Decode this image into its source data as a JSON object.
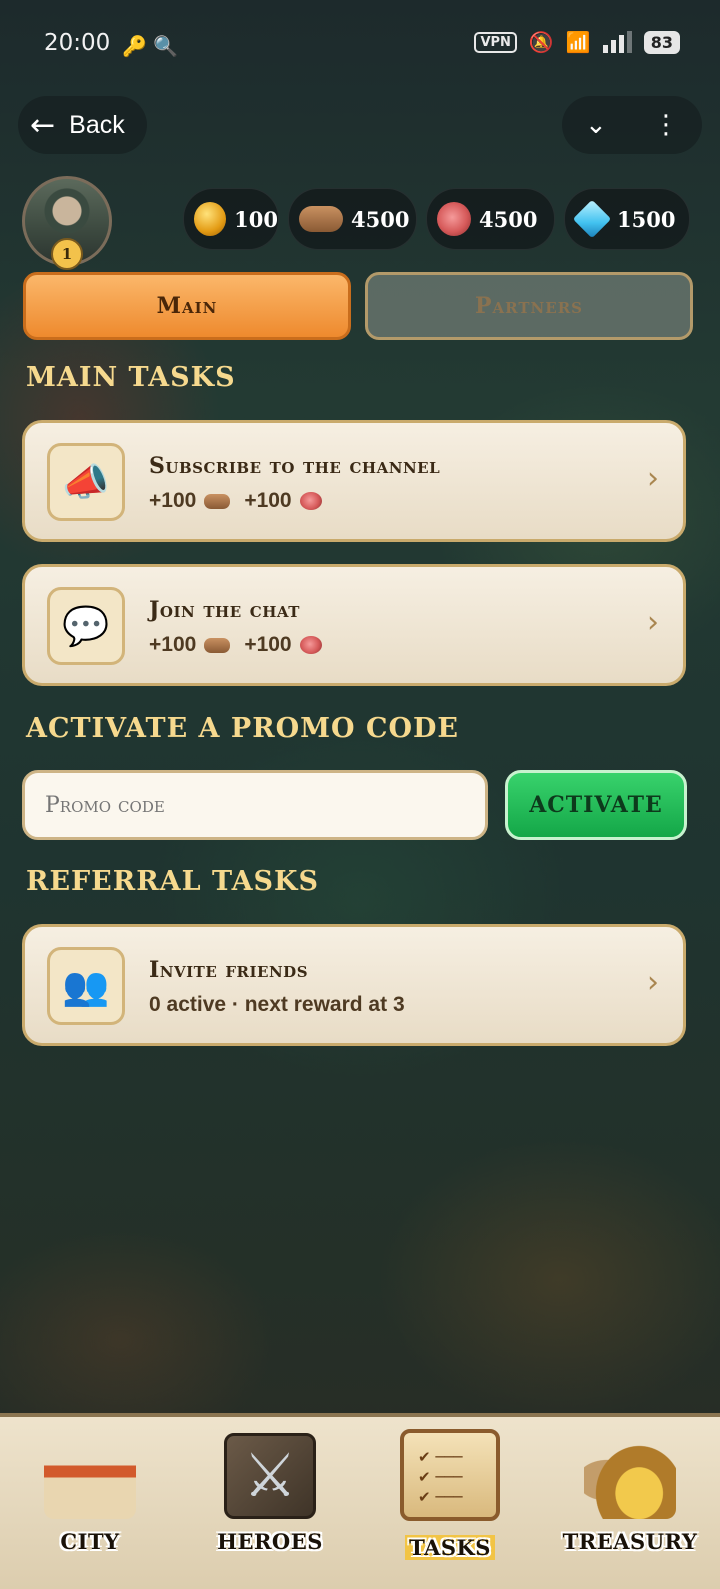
{
  "status_bar": {
    "time": "20:00",
    "left_icons": "🔑 🔍",
    "vpn": "VPN",
    "battery": "83"
  },
  "header": {
    "back_label": "Back",
    "dropdown_icon": "chevron-down-icon",
    "menu_icon": "more-vertical-icon"
  },
  "player": {
    "level": "1"
  },
  "resources": [
    {
      "name": "gold",
      "value": "100"
    },
    {
      "name": "wood",
      "value": "4500"
    },
    {
      "name": "meat",
      "value": "4500"
    },
    {
      "name": "gems",
      "value": "1500"
    }
  ],
  "tabs": {
    "main": "Main",
    "partners": "Partners"
  },
  "sections": {
    "main_tasks": "MAIN TASKS",
    "promo": "ACTIVATE A PROMO CODE",
    "referral": "REFERRAL TASKS"
  },
  "tasks": [
    {
      "title": "Subscribe to the channel",
      "reward_wood": "+100",
      "reward_meat": "+100",
      "icon": "megaphone-icon"
    },
    {
      "title": "Join the chat",
      "reward_wood": "+100",
      "reward_meat": "+100",
      "icon": "speech-bubble-icon"
    }
  ],
  "promo": {
    "placeholder": "Promo code",
    "button": "ACTIVATE"
  },
  "referral": {
    "title": "Invite friends",
    "subtitle": "0 active · next reward at 3",
    "icon": "people-icon"
  },
  "nav": [
    {
      "label": "CITY"
    },
    {
      "label": "HEROES"
    },
    {
      "label": "TASKS",
      "active": true
    },
    {
      "label": "TREASURY"
    }
  ],
  "colors": {
    "tab_active": "#ee8a2e",
    "activate": "#14a748",
    "section_text": "#f6d98e",
    "card": "#f6efe2"
  }
}
